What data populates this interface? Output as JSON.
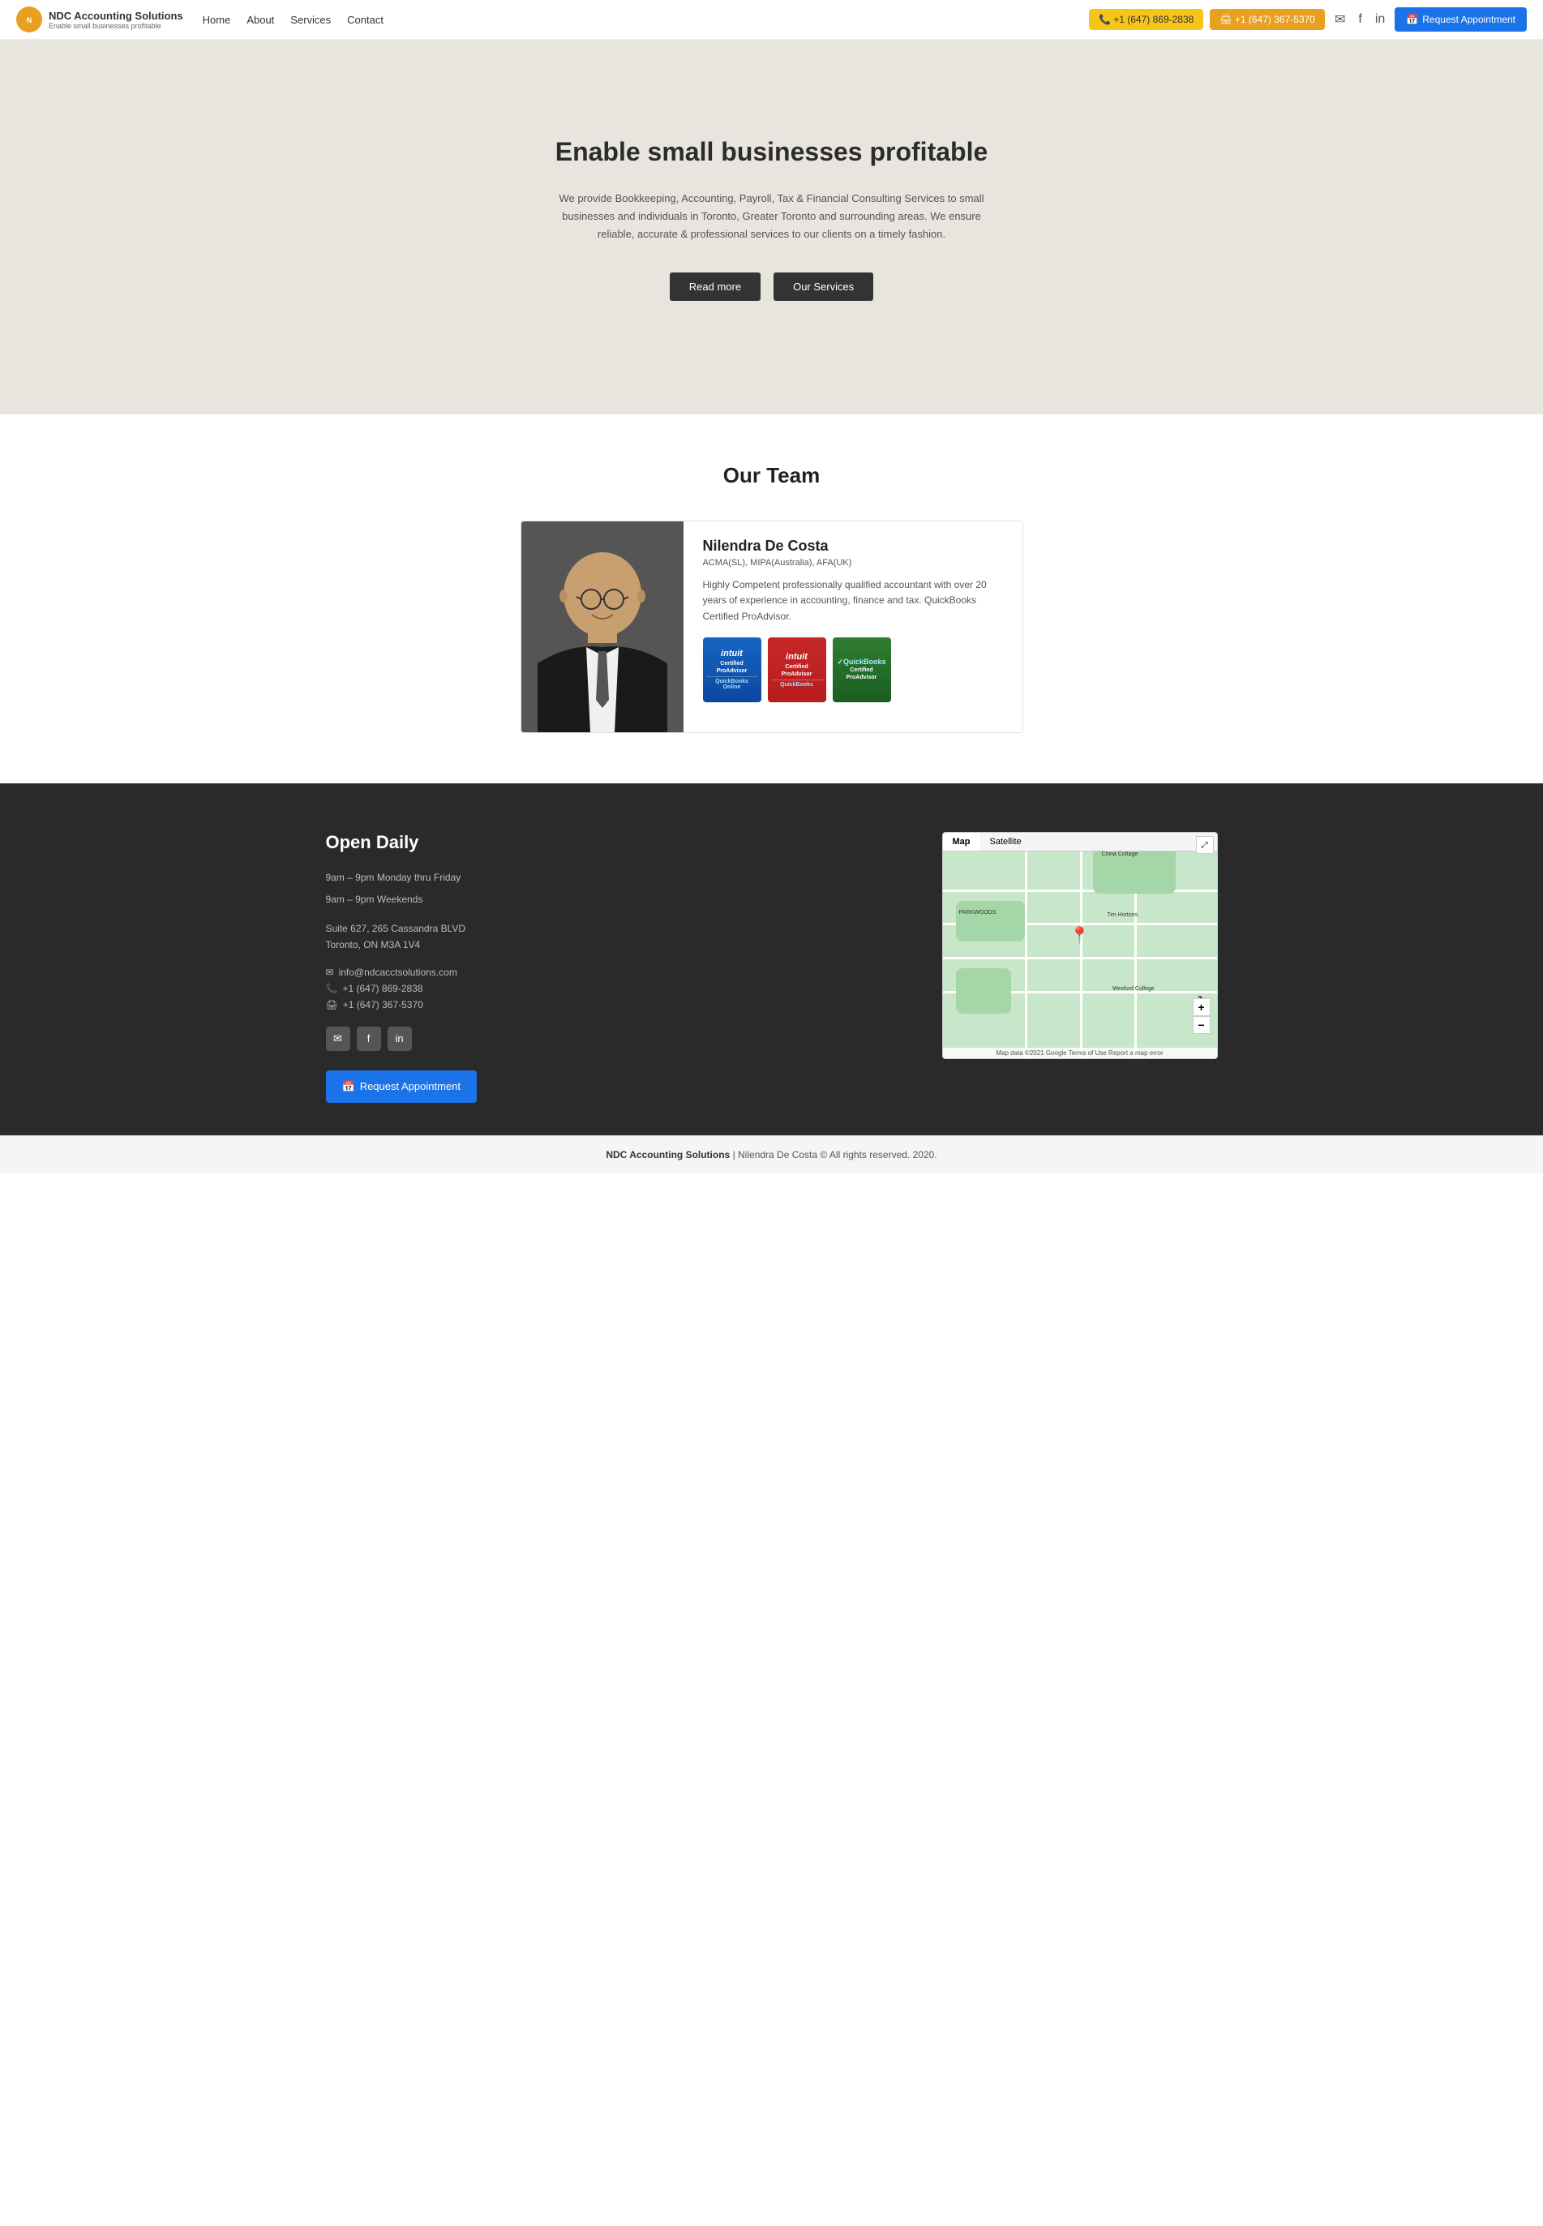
{
  "navbar": {
    "logo_title": "NDC Accounting Solutions",
    "logo_subtitle": "Enable small businesses profitable",
    "nav_links": [
      {
        "label": "Home",
        "href": "#"
      },
      {
        "label": "About",
        "href": "#"
      },
      {
        "label": "Services",
        "href": "#"
      },
      {
        "label": "Contact",
        "href": "#"
      }
    ],
    "phone_label": "📞 +1 (647) 869-2838",
    "fax_label": "🖨 +1 (647) 367-5370",
    "appointment_label": "Request Appointment"
  },
  "hero": {
    "title": "Enable small businesses profitable",
    "description": "We provide Bookkeeping, Accounting, Payroll, Tax & Financial Consulting Services to small businesses and individuals in Toronto, Greater Toronto and surrounding areas. We ensure reliable, accurate & professional services to our clients on a timely fashion.",
    "btn_read_more": "Read more",
    "btn_services": "Our Services"
  },
  "team": {
    "section_title": "Our Team",
    "member": {
      "name": "Nilendra De Costa",
      "credentials": "ACMA(SL), MIPA(Australia), AFA(UK)",
      "bio": "Highly Competent professionally qualified accountant with over 20 years of experience in accounting, finance and tax. QuickBooks Certified ProAdvisor.",
      "certs": [
        {
          "type": "intuit-blue",
          "logo": "intuit",
          "line1": "Certified",
          "line2": "ProAdvisor",
          "sub": "QuickBooks Online"
        },
        {
          "type": "intuit-red",
          "logo": "intuit",
          "line1": "Certified",
          "line2": "ProAdvisor",
          "sub": "QuickBooks"
        },
        {
          "type": "quickbooks-green",
          "logo": "✓",
          "line1": "Certified",
          "line2": "ProAdvisor",
          "sub": ""
        }
      ]
    }
  },
  "footer": {
    "heading": "Open Daily",
    "hours_line1": "9am – 9pm Monday thru Friday",
    "hours_line2": "9am – 9pm Weekends",
    "address_line1": "Suite 627, 265 Cassandra BLVD",
    "address_line2": "Toronto, ON M3A 1V4",
    "email": "info@ndcacctsolutions.com",
    "phone": "+1 (647) 869-2838",
    "fax": "+1 (647) 367-5370",
    "appointment_btn": "Request Appointment",
    "map": {
      "tab_map": "Map",
      "tab_satellite": "Satellite",
      "attribution": "Map data ©2021 Google  Terms of Use  Report a map error"
    }
  },
  "bottom_footer": {
    "company": "NDC Accounting Solutions",
    "text": " | Nilendra De Costa © All rights reserved. 2020."
  }
}
